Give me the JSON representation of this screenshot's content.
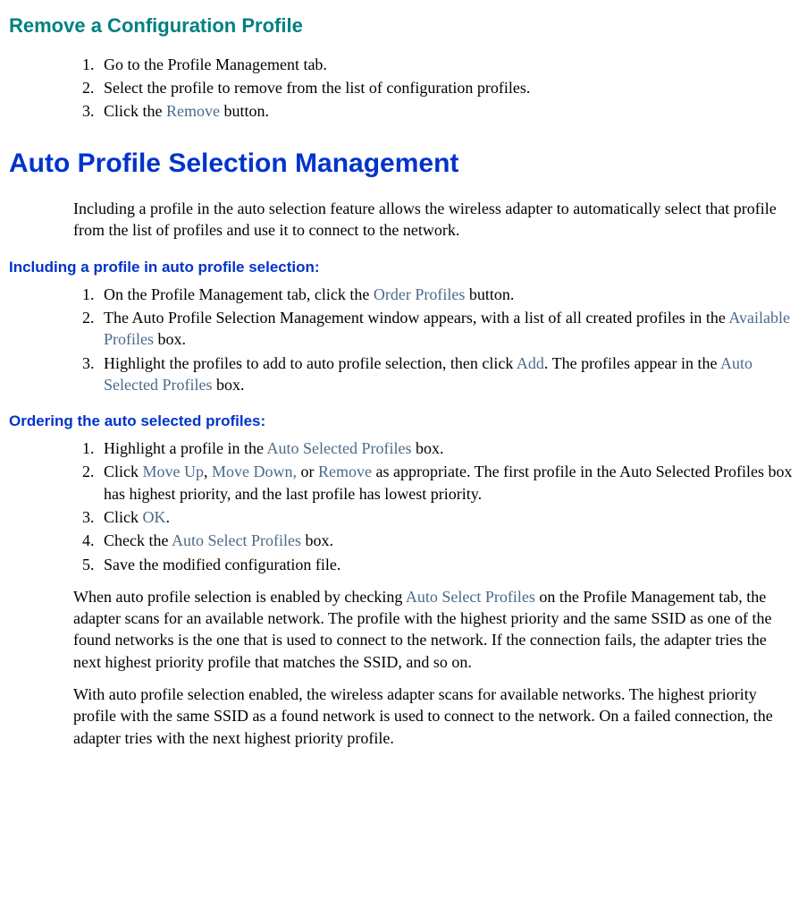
{
  "remove_profile": {
    "title": "Remove a Configuration Profile",
    "steps": {
      "s1": "Go to the Profile Management tab.",
      "s2": "Select the profile to remove from the list of configuration profiles.",
      "s3a": "Click the ",
      "s3_link": "Remove",
      "s3b": " button."
    }
  },
  "auto_profile": {
    "title": "Auto Profile Selection Management",
    "intro": "Including a profile in the auto selection feature allows the wireless adapter to automatically select that profile from the list of profiles and use it to connect to the network.",
    "include_title": "Including a profile in auto profile selection:",
    "include_steps": {
      "s1a": "On the Profile Management tab, click the ",
      "s1_link": "Order Profiles",
      "s1b": " button.",
      "s2a": "The Auto Profile Selection Management window appears, with a list of all created profiles in the ",
      "s2_link": "Available Profiles",
      "s2b": " box.",
      "s3a": "Highlight the profiles to add to auto profile selection, then click ",
      "s3_link": "Add",
      "s3b": ". The profiles appear in the ",
      "s3_link2": "Auto Selected Profiles",
      "s3c": " box."
    },
    "order_title": "Ordering the auto selected profiles:",
    "order_steps": {
      "s1a": "Highlight a profile in the ",
      "s1_link": "Auto Selected Profiles",
      "s1b": " box.",
      "s2a": "Click ",
      "s2_link1": "Move Up",
      "s2_sep1": ", ",
      "s2_link2": "Move Down,",
      "s2_sep2": " or ",
      "s2_link3": "Remove",
      "s2b": " as appropriate. The first profile in the Auto Selected Profiles box has highest priority, and the last profile has lowest priority.",
      "s3a": "Click ",
      "s3_link": "OK",
      "s3b": ".",
      "s4a": "Check the ",
      "s4_link": "Auto Select Profiles",
      "s4b": " box.",
      "s5": "Save the modified configuration file."
    },
    "para1a": "When auto profile selection is enabled by checking ",
    "para1_link": "Auto Select Profiles",
    "para1b": " on the Profile Management tab, the  adapter scans for an available network. The profile with the highest priority and the same SSID as one of the found networks is the one that is used to connect to the network. If the connection fails, the  adapter tries the next highest priority profile that matches the SSID, and so on.",
    "para2": "With auto profile selection enabled, the wireless adapter scans for available networks. The highest priority profile with the same SSID as a found network is used to connect to the network. On a failed connection, the  adapter tries with the next highest priority profile."
  }
}
